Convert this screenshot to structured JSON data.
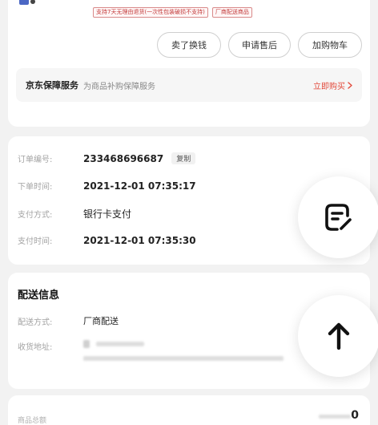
{
  "product": {
    "tags": [
      "支持7天无理由退货(一次性包装破损不支持)",
      "厂商配送商品"
    ]
  },
  "actions": {
    "buy_again": "卖了换钱",
    "after_sales": "申请售后",
    "add_to_cart": "加购物车"
  },
  "service": {
    "title": "京东保障服务",
    "desc": "为商品补购保障服务",
    "link": "立即购买"
  },
  "order": {
    "number_label": "订单编号:",
    "number_value": "233468696687",
    "copy_label": "复制",
    "order_time_label": "下单时间:",
    "order_time_value": "2021-12-01 07:35:17",
    "pay_method_label": "支付方式:",
    "pay_method_value": "银行卡支付",
    "pay_time_label": "支付时间:",
    "pay_time_value": "2021-12-01 07:35:30"
  },
  "delivery": {
    "title": "配送信息",
    "method_label": "配送方式:",
    "method_value": "厂商配送",
    "address_label": "收货地址:"
  },
  "summary": {
    "total_label": "商品总额",
    "total_value_partial": "0"
  },
  "colors": {
    "accent": "#e24a3b",
    "page_bg": "#f2f2f2",
    "card_bg": "#ffffff"
  },
  "icons": {
    "fab_top": "edit-note-icon",
    "fab_bottom": "arrow-up-icon",
    "service_link": "chevron-right-icon"
  }
}
